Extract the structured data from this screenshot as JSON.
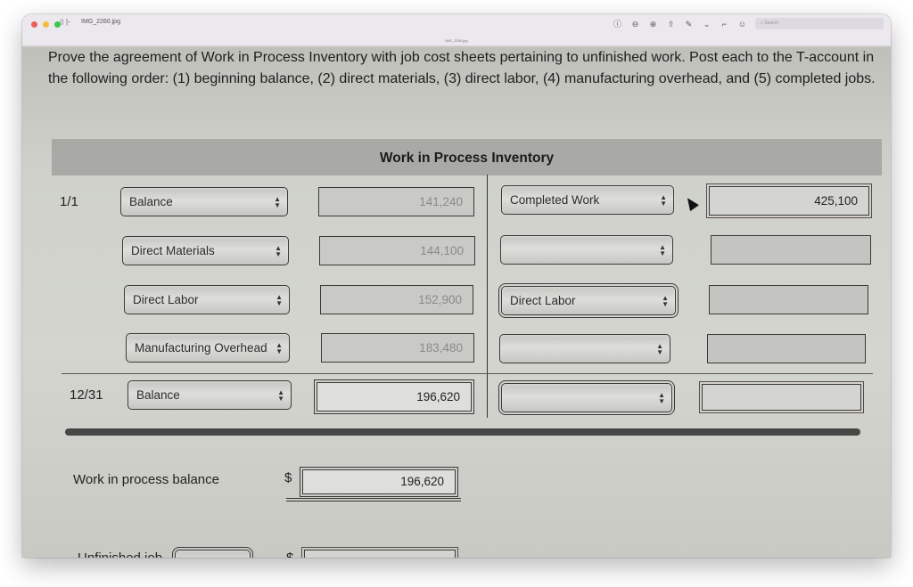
{
  "window": {
    "title": "IMG_2260.jpg",
    "subtitle": "IMG_2260.jpg",
    "sidebar_toggle": "⌷ |-",
    "toolbar": {
      "icons": [
        {
          "name": "info-icon",
          "glyph": "ⓘ"
        },
        {
          "name": "zoom-out-icon",
          "glyph": "⊖"
        },
        {
          "name": "zoom-in-icon",
          "glyph": "⊕"
        },
        {
          "name": "share-icon",
          "glyph": "⇧"
        },
        {
          "name": "markup-icon",
          "glyph": "✎"
        },
        {
          "name": "markup-dropdown-icon",
          "glyph": "⌄"
        },
        {
          "name": "rotate-icon",
          "glyph": "⌐"
        },
        {
          "name": "annotate-icon",
          "glyph": "☺"
        }
      ],
      "search_placeholder": "⌕ Search"
    }
  },
  "instructions": "Prove the agreement of Work in Process Inventory with job cost sheets pertaining to unfinished work. Post each to the T-account in the following order: (1) beginning balance, (2) direct materials, (3) direct labor, (4) manufacturing overhead, and (5) completed jobs.",
  "t_account": {
    "title": "Work in Process Inventory",
    "debit_rows": [
      {
        "date": "1/1",
        "account": "Balance",
        "amount": "141,240"
      },
      {
        "date": "",
        "account": "Direct Materials",
        "amount": "144,100"
      },
      {
        "date": "",
        "account": "Direct Labor",
        "amount": "152,900"
      },
      {
        "date": "",
        "account": "Manufacturing Overhead",
        "amount": "183,480"
      }
    ],
    "credit_rows": [
      {
        "account": "Completed Work",
        "amount": "425,100"
      },
      {
        "account": "",
        "amount": ""
      },
      {
        "account": "Direct Labor",
        "amount": ""
      },
      {
        "account": "",
        "amount": ""
      }
    ],
    "ending": {
      "date": "12/31",
      "debit_account": "Balance",
      "debit_amount": "196,620",
      "credit_account": "",
      "credit_amount": ""
    }
  },
  "summary": {
    "wip_balance_label": "Work in process balance",
    "currency": "$",
    "wip_balance_value": "196,620",
    "unfinished_job_label": "Unfinished job",
    "unfinished_job_select": "",
    "unfinished_job_value": ""
  },
  "select_arrows": "▲▼"
}
